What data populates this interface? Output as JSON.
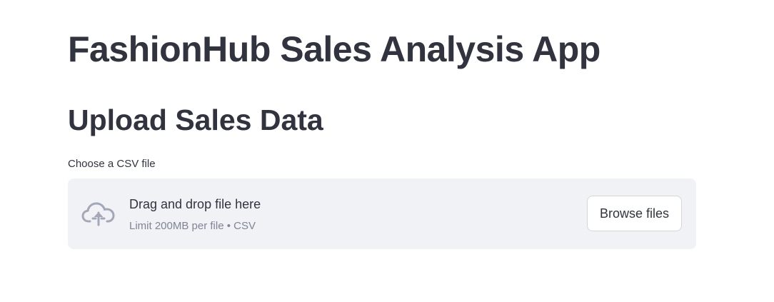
{
  "page": {
    "title": "FashionHub Sales Analysis App"
  },
  "upload_section": {
    "heading": "Upload Sales Data",
    "field_label": "Choose a CSV file",
    "dropzone": {
      "icon": "cloud-upload-icon",
      "instruction": "Drag and drop file here",
      "limit_text": "Limit 200MB per file • CSV",
      "browse_label": "Browse files"
    }
  },
  "colors": {
    "text": "#31333f",
    "muted_text": "#808495",
    "dropzone_bg": "#f0f2f6",
    "icon": "#a3a8b8",
    "button_border": "#d6d6d9"
  }
}
